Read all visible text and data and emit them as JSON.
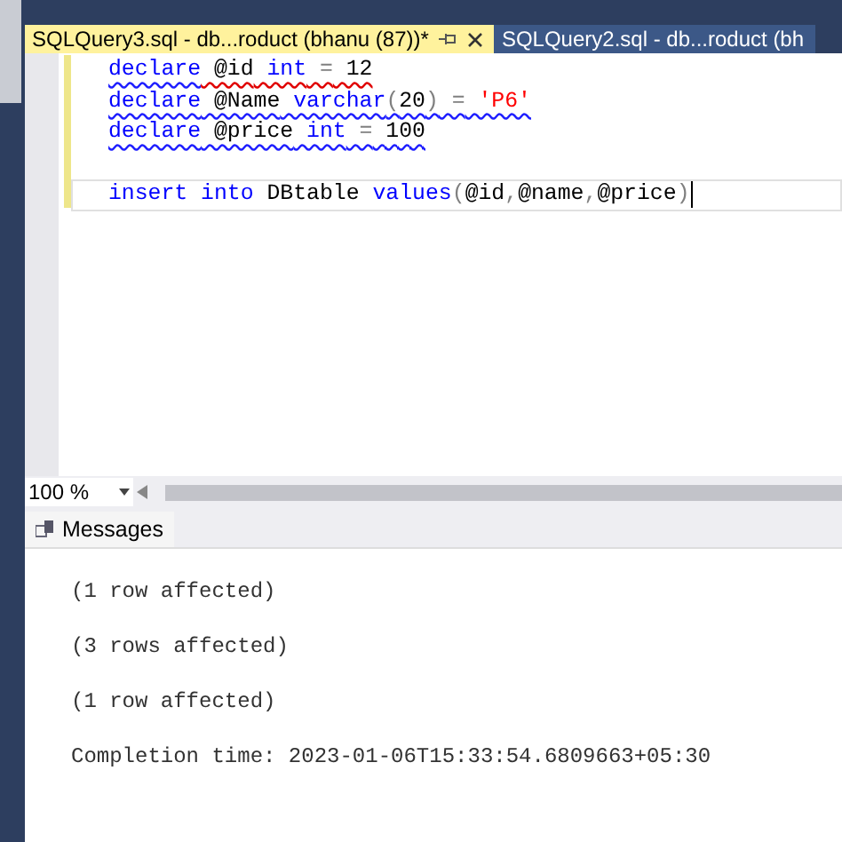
{
  "tabs": [
    {
      "label": "SQLQuery3.sql - db...roduct (bhanu (87))*",
      "selected": true,
      "pinned": true,
      "closable": true
    },
    {
      "label": "SQLQuery2.sql - db...roduct (bh",
      "selected": false,
      "pinned": false,
      "closable": false
    }
  ],
  "editor": {
    "lines": [
      {
        "current": false,
        "warning_squiggle": true,
        "tokens": [
          {
            "text": "declare",
            "kind": "keyword",
            "error_squiggle": false
          },
          {
            "text": " @id",
            "kind": "plain",
            "error_squiggle": true
          },
          {
            "text": " int",
            "kind": "keyword",
            "error_squiggle": true
          },
          {
            "text": " =",
            "kind": "operator",
            "error_squiggle": true
          },
          {
            "text": " 12",
            "kind": "plain",
            "error_squiggle": true
          }
        ]
      },
      {
        "current": false,
        "warning_squiggle": true,
        "tokens": [
          {
            "text": "declare",
            "kind": "keyword"
          },
          {
            "text": " @Name",
            "kind": "plain"
          },
          {
            "text": " varchar",
            "kind": "keyword"
          },
          {
            "text": "(",
            "kind": "operator"
          },
          {
            "text": "20",
            "kind": "plain"
          },
          {
            "text": ")",
            "kind": "operator"
          },
          {
            "text": " =",
            "kind": "operator"
          },
          {
            "text": " 'P6'",
            "kind": "string"
          }
        ]
      },
      {
        "current": false,
        "warning_squiggle": true,
        "tokens": [
          {
            "text": "declare",
            "kind": "keyword"
          },
          {
            "text": " @price",
            "kind": "plain"
          },
          {
            "text": " int",
            "kind": "keyword"
          },
          {
            "text": " =",
            "kind": "operator"
          },
          {
            "text": " 100",
            "kind": "plain"
          }
        ]
      },
      {
        "current": false
      },
      {
        "current": true,
        "warning_squiggle": false,
        "tokens": [
          {
            "text": "insert",
            "kind": "keyword"
          },
          {
            "text": " into",
            "kind": "keyword"
          },
          {
            "text": " DBtable",
            "kind": "plain"
          },
          {
            "text": " values",
            "kind": "keyword"
          },
          {
            "text": "(",
            "kind": "operator"
          },
          {
            "text": "@id",
            "kind": "plain"
          },
          {
            "text": ",",
            "kind": "operator"
          },
          {
            "text": "@name",
            "kind": "plain"
          },
          {
            "text": ",",
            "kind": "operator"
          },
          {
            "text": "@price",
            "kind": "plain"
          },
          {
            "text": ")",
            "kind": "operator"
          }
        ]
      }
    ]
  },
  "zoom": {
    "value": "100 %"
  },
  "results_tabs": [
    {
      "label": "Messages",
      "selected": true
    }
  ],
  "messages": [
    "(1 row affected)",
    "(3 rows affected)",
    "(1 row affected)",
    "Completion time: 2023-01-06T15:33:54.6809663+05:30"
  ]
}
